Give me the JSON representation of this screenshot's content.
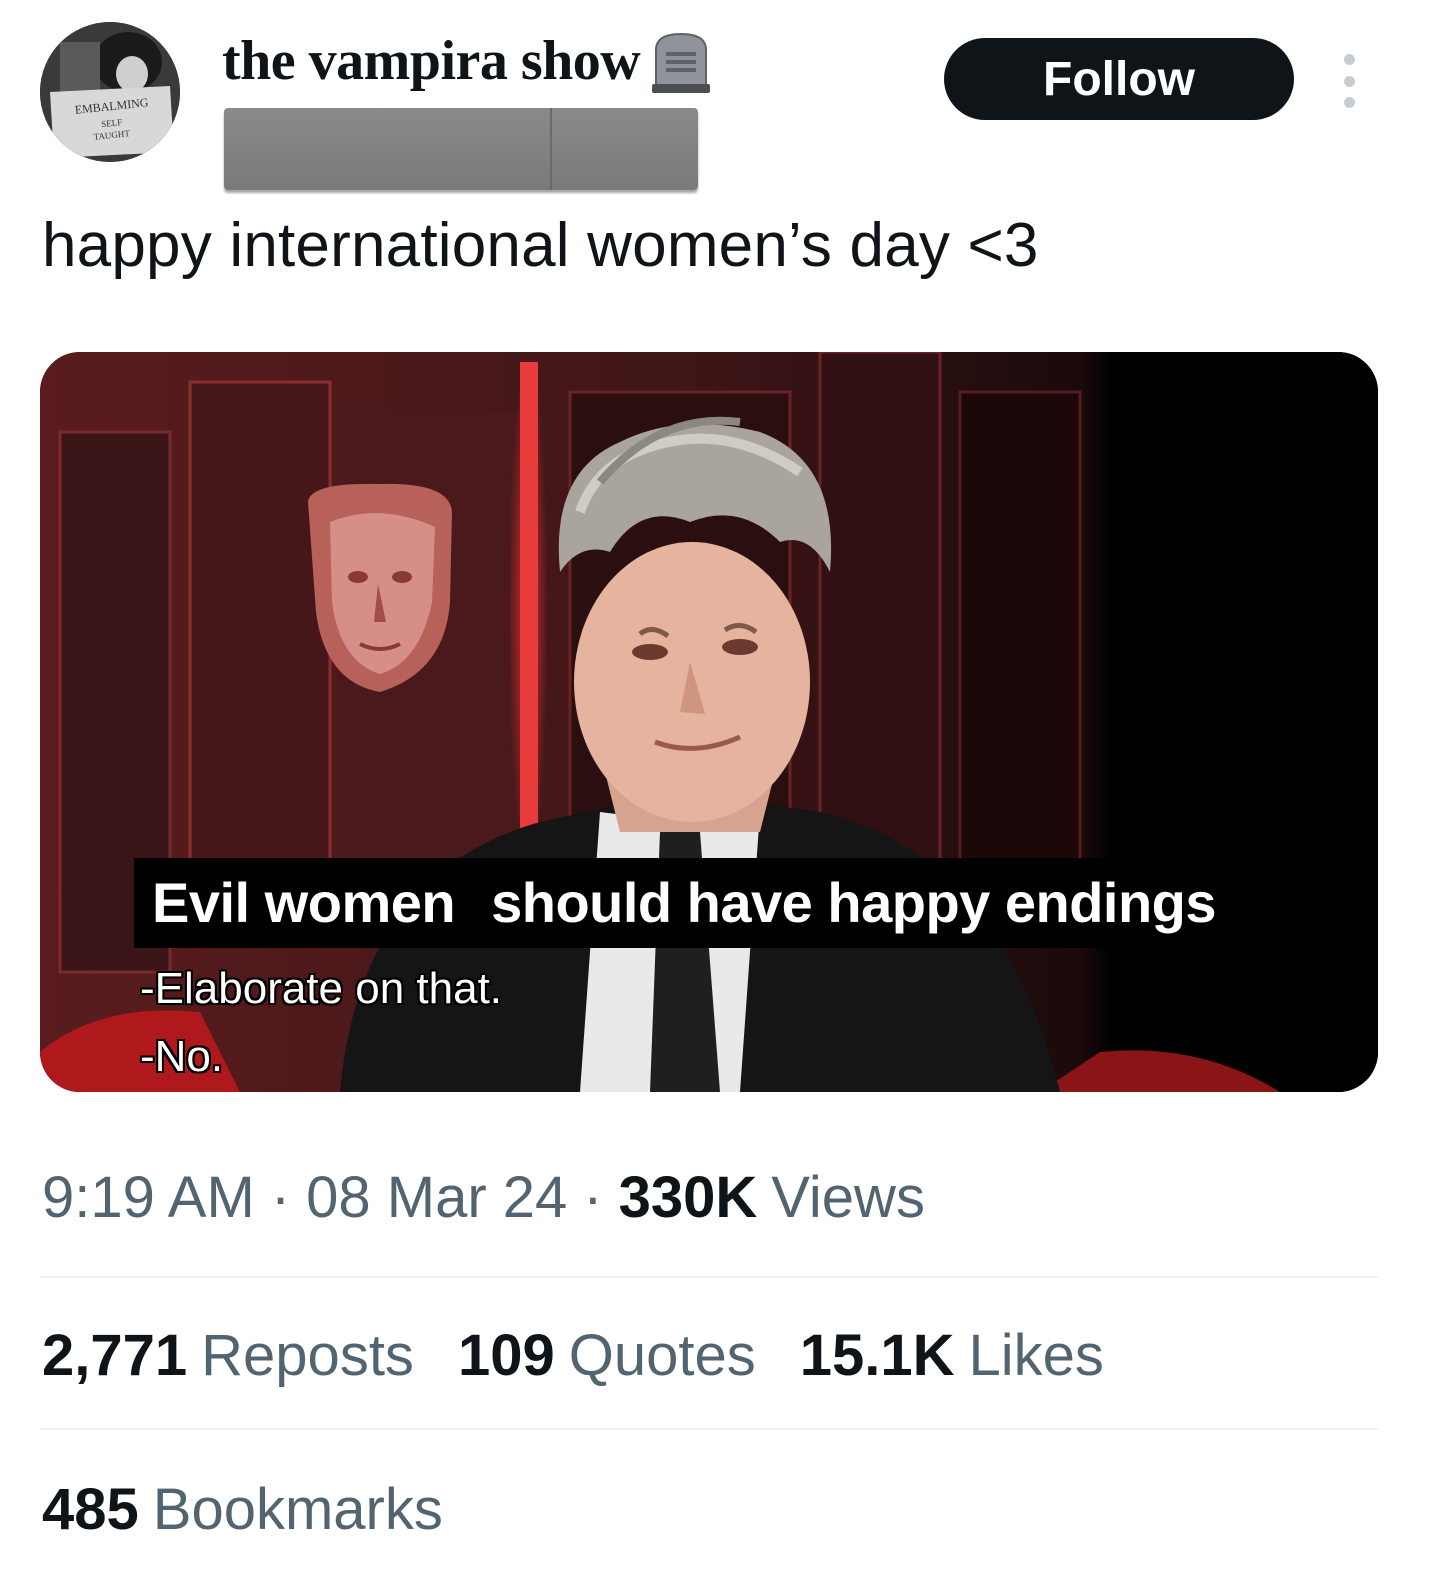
{
  "user": {
    "display_name": "the vampira show",
    "name_emoji": "headstone-icon",
    "handle": "",
    "avatar_sign_text": [
      "EMBALMING",
      "SELF",
      "TAUGHT"
    ]
  },
  "header": {
    "follow_label": "Follow",
    "more_icon": "ellipsis-vertical-icon"
  },
  "tweet": {
    "text": "happy international women’s day <3"
  },
  "media": {
    "caption_main_1": "Evil women",
    "caption_main_2": "should have happy endings",
    "caption_sub_1": "-Elaborate on that.",
    "caption_sub_2": "-No."
  },
  "meta": {
    "time": "9:19 AM",
    "date": "08 Mar 24",
    "separator": "·",
    "views_count": "330K",
    "views_label": "Views"
  },
  "stats": {
    "reposts_count": "2,771",
    "reposts_label": "Reposts",
    "quotes_count": "109",
    "quotes_label": "Quotes",
    "likes_count": "15.1K",
    "likes_label": "Likes",
    "bookmarks_count": "485",
    "bookmarks_label": "Bookmarks"
  },
  "colors": {
    "text_primary": "#0f1419",
    "text_secondary": "#536471",
    "follow_bg": "#0f1419",
    "divider": "#eff3f4"
  }
}
